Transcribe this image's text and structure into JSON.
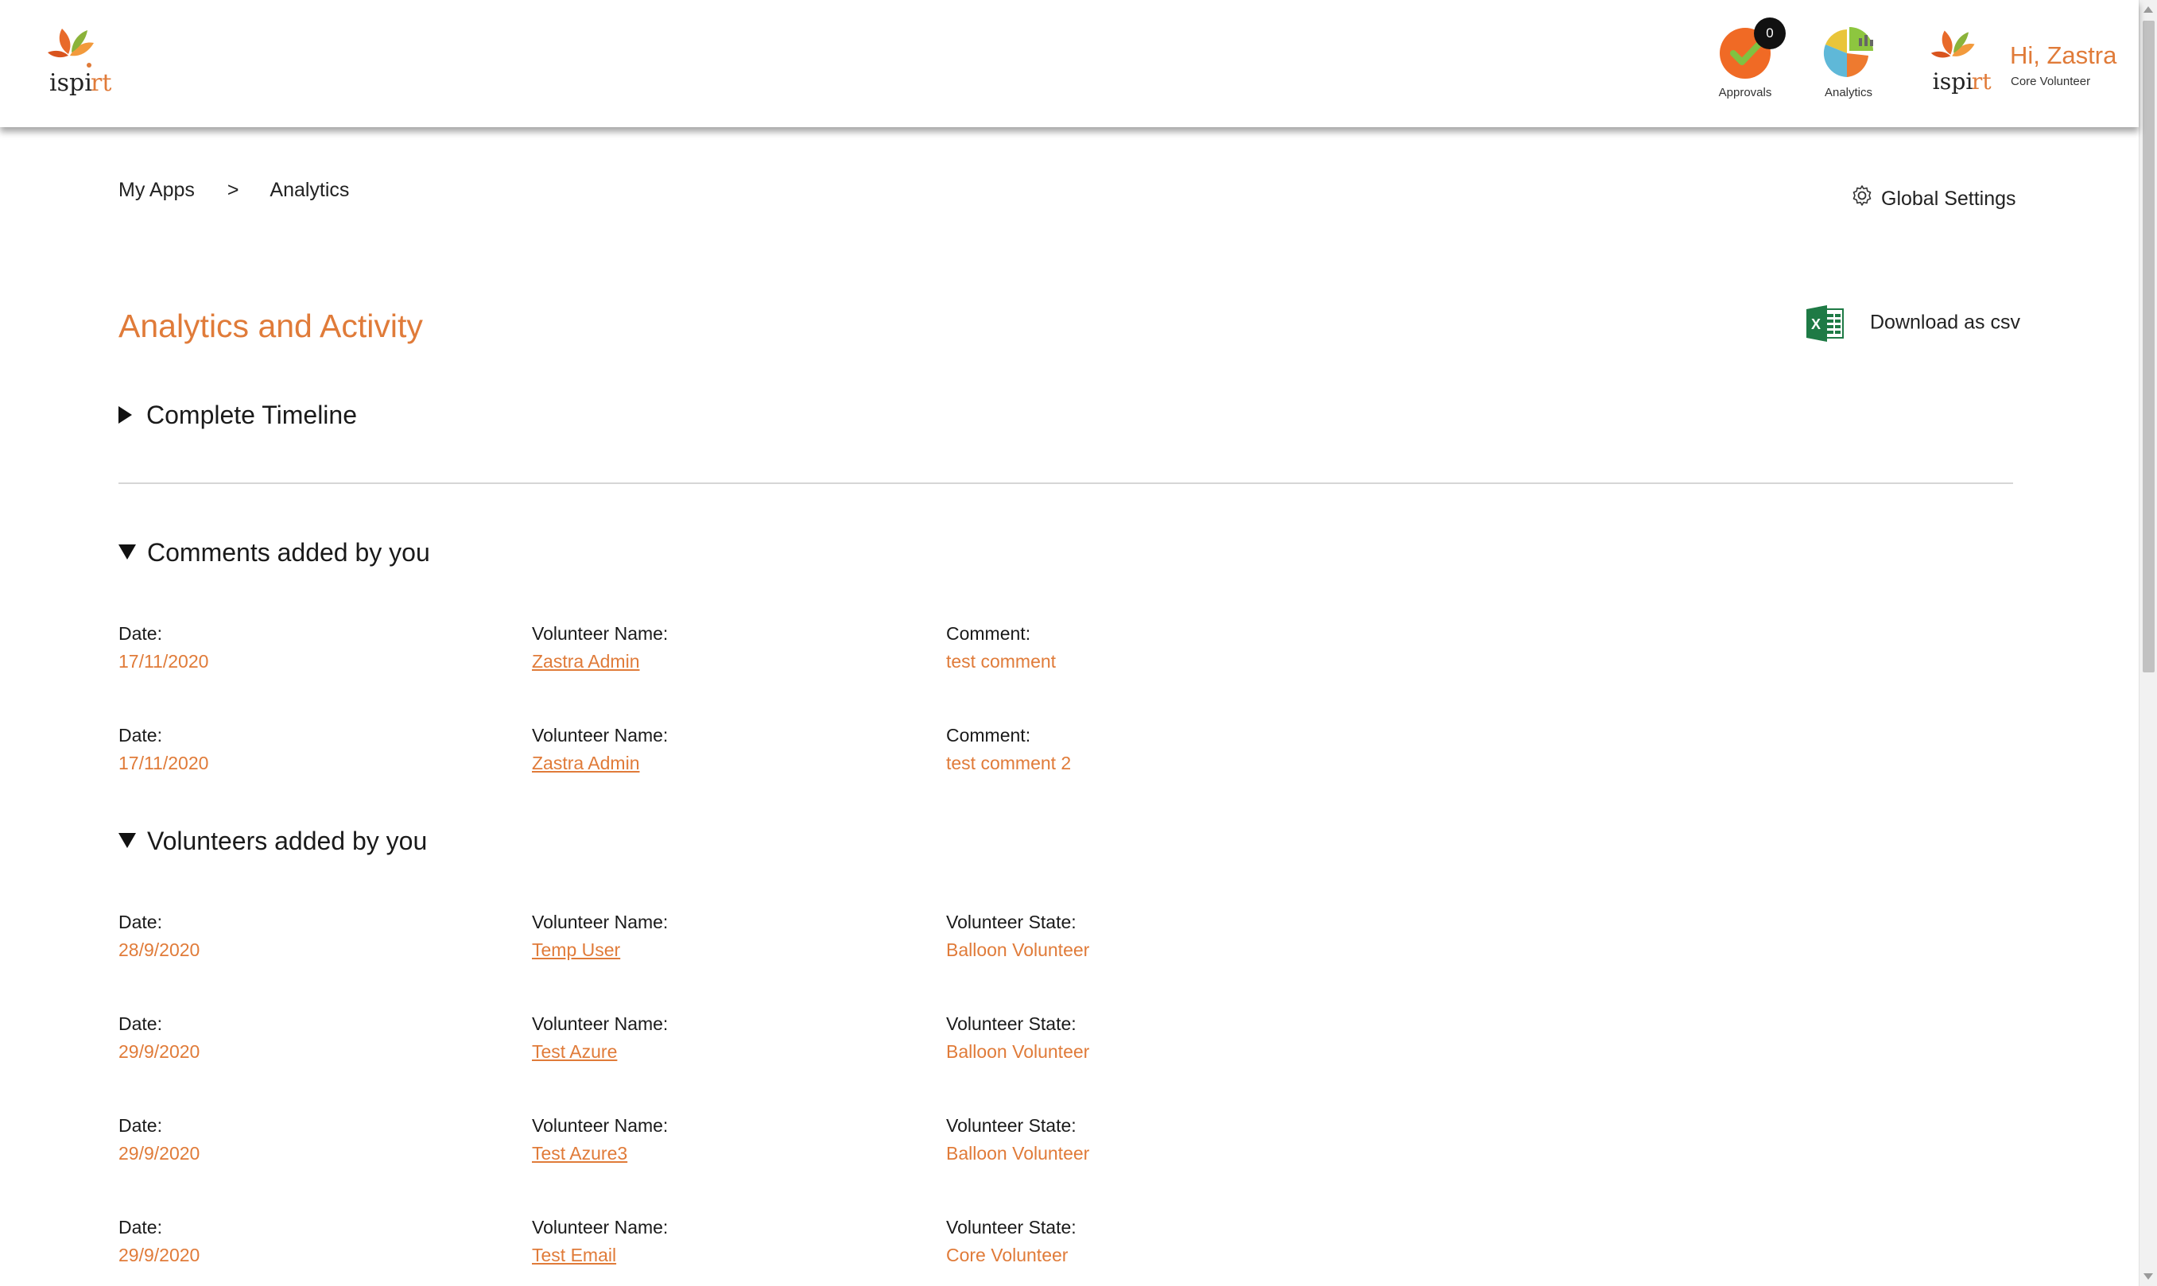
{
  "header": {
    "brand": "ispirt",
    "approvals": {
      "label": "Approvals",
      "count": "0"
    },
    "analytics": {
      "label": "Analytics"
    },
    "user": {
      "greeting": "Hi, Zastra",
      "role": "Core Volunteer"
    }
  },
  "breadcrumb": {
    "root": "My Apps",
    "separator": ">",
    "current": "Analytics"
  },
  "global_settings": {
    "label": "Global Settings"
  },
  "page_title": "Analytics and Activity",
  "download": {
    "label": "Download as csv"
  },
  "timeline": {
    "title": "Complete Timeline",
    "expanded": false
  },
  "comments": {
    "title": "Comments added by you",
    "expanded": true,
    "date_label": "Date:",
    "name_label": "Volunteer Name:",
    "comment_label": "Comment:",
    "rows": [
      {
        "date": "17/11/2020",
        "name": "Zastra Admin",
        "comment": "test comment"
      },
      {
        "date": "17/11/2020",
        "name": "Zastra Admin",
        "comment": "test comment 2"
      }
    ]
  },
  "volunteers": {
    "title": "Volunteers added by you",
    "expanded": true,
    "date_label": "Date:",
    "name_label": "Volunteer Name:",
    "state_label": "Volunteer State:",
    "rows": [
      {
        "date": "28/9/2020",
        "name": "Temp User",
        "state": "Balloon Volunteer"
      },
      {
        "date": "29/9/2020",
        "name": "Test Azure",
        "state": "Balloon Volunteer"
      },
      {
        "date": "29/9/2020",
        "name": "Test Azure3",
        "state": "Balloon Volunteer"
      },
      {
        "date": "29/9/2020",
        "name": "Test Email",
        "state": "Core Volunteer"
      }
    ]
  },
  "colors": {
    "accent": "#e07b39",
    "text": "#1a1a1a",
    "divider": "#d6d6d6"
  }
}
